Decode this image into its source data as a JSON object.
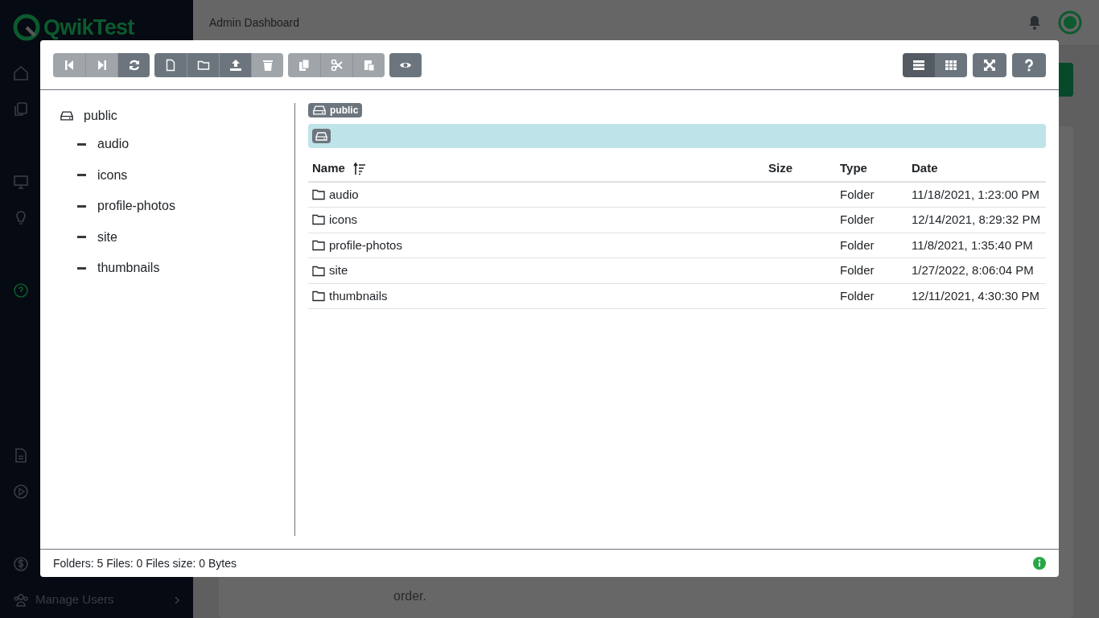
{
  "app": {
    "logo": "QwikTest",
    "header_title": "Admin Dashboard"
  },
  "sidebar": {
    "footer_item": "Manage Users"
  },
  "background_text": "order.",
  "file_manager": {
    "toolbar_left": [
      [
        {
          "disabled": true
        },
        {
          "disabled": true
        },
        {
          "disabled": false
        }
      ],
      [
        {
          "disabled": false
        },
        {
          "disabled": false
        },
        {
          "disabled": false
        },
        {
          "disabled": true
        }
      ],
      [
        {
          "disabled": true
        },
        {
          "disabled": true
        },
        {
          "disabled": true
        }
      ],
      [
        {
          "disabled": false
        }
      ]
    ],
    "view_modes": [
      {
        "selected": true
      },
      {
        "selected": false
      }
    ],
    "tree": {
      "label": "public",
      "children": [
        {
          "label": "audio"
        },
        {
          "label": "icons"
        },
        {
          "label": "profile-photos"
        },
        {
          "label": "site"
        },
        {
          "label": "thumbnails"
        }
      ]
    },
    "breadcrumb": "public",
    "table": {
      "columns": [
        "Name",
        "Size",
        "Type",
        "Date"
      ],
      "rows": [
        {
          "name": "audio",
          "type": "Folder",
          "date": "11/18/2021, 1:23:00 PM"
        },
        {
          "name": "icons",
          "type": "Folder",
          "date": "12/14/2021, 8:29:32 PM"
        },
        {
          "name": "profile-photos",
          "type": "Folder",
          "date": "11/8/2021, 1:35:40 PM"
        },
        {
          "name": "site",
          "type": "Folder",
          "date": "1/27/2022, 8:06:04 PM"
        },
        {
          "name": "thumbnails",
          "type": "Folder",
          "date": "12/11/2021, 4:30:30 PM"
        }
      ]
    },
    "status_bar": "Folders: 5 Files: 0 Files size: 0 Bytes"
  }
}
